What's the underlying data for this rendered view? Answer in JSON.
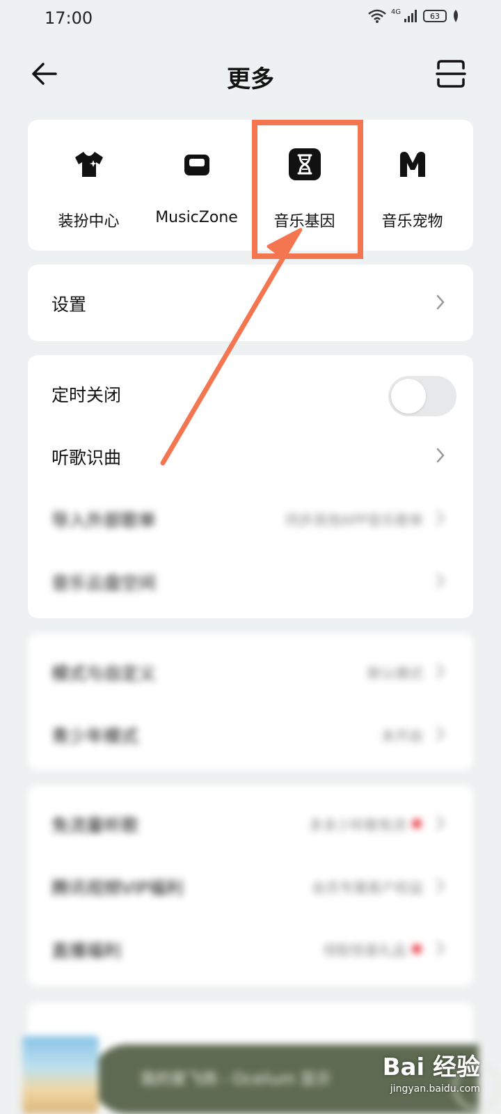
{
  "status_bar": {
    "time": "17:00",
    "network": "4G",
    "battery": "63"
  },
  "header": {
    "title": "更多"
  },
  "quick_grid": [
    {
      "label": "装扮中心",
      "icon": "tshirt-icon"
    },
    {
      "label": "MusicZone",
      "icon": "sofa-icon"
    },
    {
      "label": "音乐基因",
      "icon": "dna-icon"
    },
    {
      "label": "音乐宠物",
      "icon": "m-logo-icon"
    }
  ],
  "settings_card": {
    "label": "设置"
  },
  "tools_card": {
    "timer_off": {
      "label": "定时关闭",
      "enabled": false
    },
    "recognize": {
      "label": "听歌识曲"
    },
    "import_playlist": {
      "label": "导入外部歌单",
      "value": "同步其他APP音乐歌单"
    },
    "cloud_space": {
      "label": "音乐云盘空间"
    }
  },
  "mode_card": {
    "rows": [
      {
        "label": "模式与自定义",
        "value": "默认模式"
      },
      {
        "label": "青少年模式",
        "value": "未开启"
      }
    ]
  },
  "benefits_card": {
    "rows": [
      {
        "label": "免流量听歌",
        "value": "多多少听歌免流"
      },
      {
        "label": "腾讯视频VIP福利",
        "value": "会员专属客户权益"
      },
      {
        "label": "直播福利",
        "value": "领取惊喜礼品"
      }
    ]
  },
  "player": {
    "title": "我的家飞扬 - Ocelium 显示"
  },
  "watermark": {
    "logo": "Bai 经验",
    "url": "jingyan.baidu.com"
  },
  "colors": {
    "annotation": "#f47650",
    "background": "#eef1f1",
    "player_bar": "#5e6b52"
  }
}
